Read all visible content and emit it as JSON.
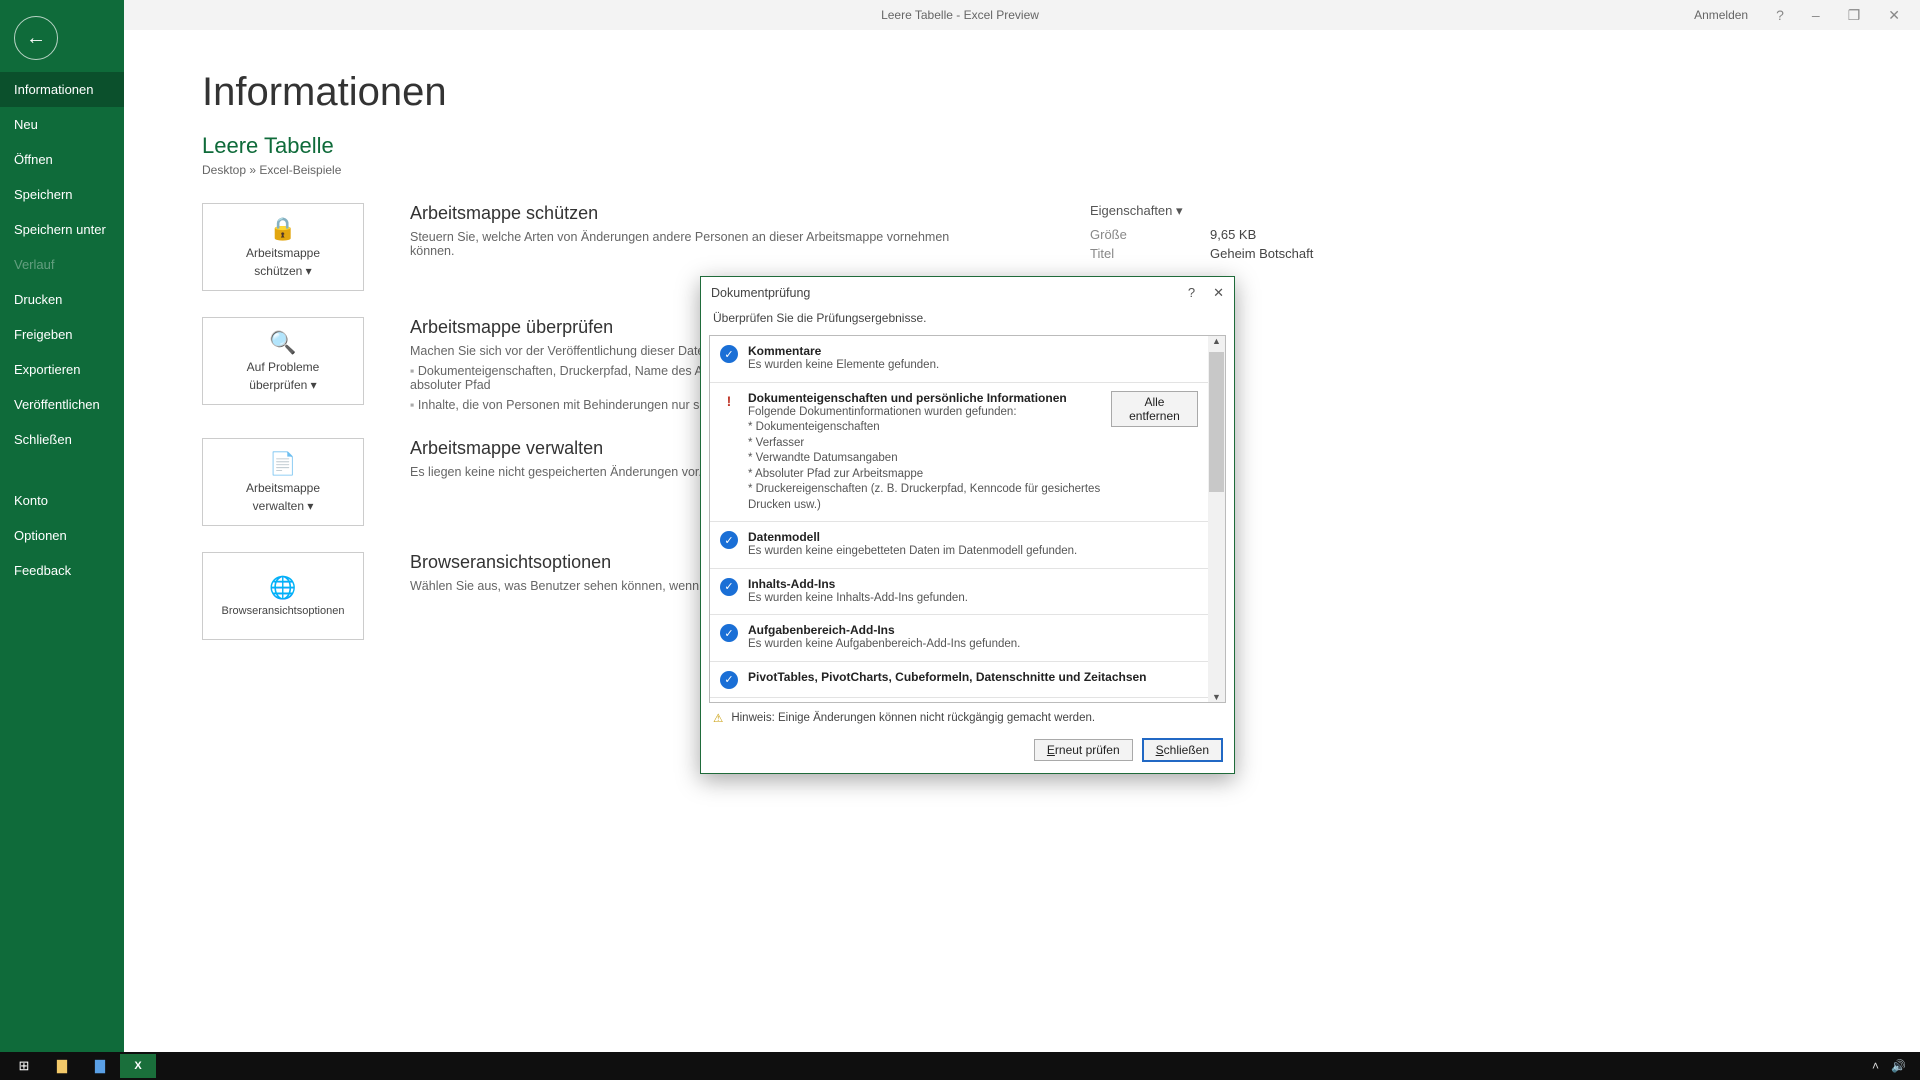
{
  "titlebar": {
    "title": "Leere Tabelle  -  Excel Preview",
    "signin": "Anmelden",
    "help": "?",
    "min": "–",
    "restore": "❐",
    "close": "✕"
  },
  "sidebar": {
    "items": [
      {
        "label": "Informationen",
        "sel": true
      },
      {
        "label": "Neu"
      },
      {
        "label": "Öffnen"
      },
      {
        "label": "Speichern"
      },
      {
        "label": "Speichern unter"
      },
      {
        "label": "Verlauf",
        "dim": true
      },
      {
        "label": "Drucken"
      },
      {
        "label": "Freigeben"
      },
      {
        "label": "Exportieren"
      },
      {
        "label": "Veröffentlichen"
      },
      {
        "label": "Schließen"
      }
    ],
    "bottom": [
      {
        "label": "Konto"
      },
      {
        "label": "Optionen"
      },
      {
        "label": "Feedback"
      }
    ]
  },
  "page": {
    "h1": "Informationen",
    "docname": "Leere Tabelle",
    "path": "Desktop » Excel-Beispiele"
  },
  "sections": {
    "protect": {
      "tile1": "Arbeitsmappe",
      "tile2": "schützen ▾",
      "h": "Arbeitsmappe schützen",
      "p": "Steuern Sie, welche Arten von Änderungen andere Personen an dieser Arbeitsmappe vornehmen können."
    },
    "inspect": {
      "tile1": "Auf Probleme",
      "tile2": "überprüfen ▾",
      "h": "Arbeitsmappe überprüfen",
      "p": "Machen Sie sich vor der Veröffentlichung dieser Datei bewusst, dass sie Folgendes enthält:",
      "li1": "Dokumenteigenschaften, Druckerpfad, Name des Autors, Verwandte Datumsangaben und absoluter Pfad",
      "li2": "Inhalte, die von Personen mit Behinderungen nur schwer gelesen werden können"
    },
    "manage": {
      "tile1": "Arbeitsmappe",
      "tile2": "verwalten ▾",
      "h": "Arbeitsmappe verwalten",
      "p": "Es liegen keine nicht gespeicherten Änderungen vor."
    },
    "browser": {
      "tile1": "Browseransichtsoptionen",
      "h": "Browseransichtsoptionen",
      "p": "Wählen Sie aus, was Benutzer sehen können, wenn diese Arbeitsmappe im Web angezeigt wird."
    }
  },
  "props": {
    "hd": "Eigenschaften ▾",
    "k1": "Größe",
    "v1": "9,65 KB",
    "k2": "Titel",
    "v2": "Geheim Botschaft"
  },
  "dialog": {
    "title": "Dokumentprüfung",
    "help": "?",
    "close": "✕",
    "sub": "Überprüfen Sie die Prüfungsergebnisse.",
    "items": [
      {
        "kind": "ok",
        "title": "Kommentare",
        "text": "Es wurden keine Elemente gefunden."
      },
      {
        "kind": "warn",
        "title": "Dokumenteigenschaften und persönliche Informationen",
        "text": "Folgende Dokumentinformationen wurden gefunden:\n* Dokumenteigenschaften\n* Verfasser\n* Verwandte Datumsangaben\n* Absoluter Pfad zur Arbeitsmappe\n* Druckereigenschaften (z. B. Druckerpfad, Kenncode für gesichertes Drucken usw.)",
        "btn": "Alle entfernen"
      },
      {
        "kind": "ok",
        "title": "Datenmodell",
        "text": "Es wurden keine eingebetteten Daten im Datenmodell gefunden."
      },
      {
        "kind": "ok",
        "title": "Inhalts-Add-Ins",
        "text": "Es wurden keine Inhalts-Add-Ins gefunden."
      },
      {
        "kind": "ok",
        "title": "Aufgabenbereich-Add-Ins",
        "text": "Es wurden keine Aufgabenbereich-Add-Ins gefunden."
      },
      {
        "kind": "ok",
        "title": "PivotTables, PivotCharts, Cubeformeln, Datenschnitte und Zeitachsen",
        "text": ""
      }
    ],
    "warnline": "Hinweis: Einige Änderungen können nicht rückgängig gemacht werden.",
    "btn_re": "Erneut prüfen",
    "btn_close": "Schließen"
  }
}
